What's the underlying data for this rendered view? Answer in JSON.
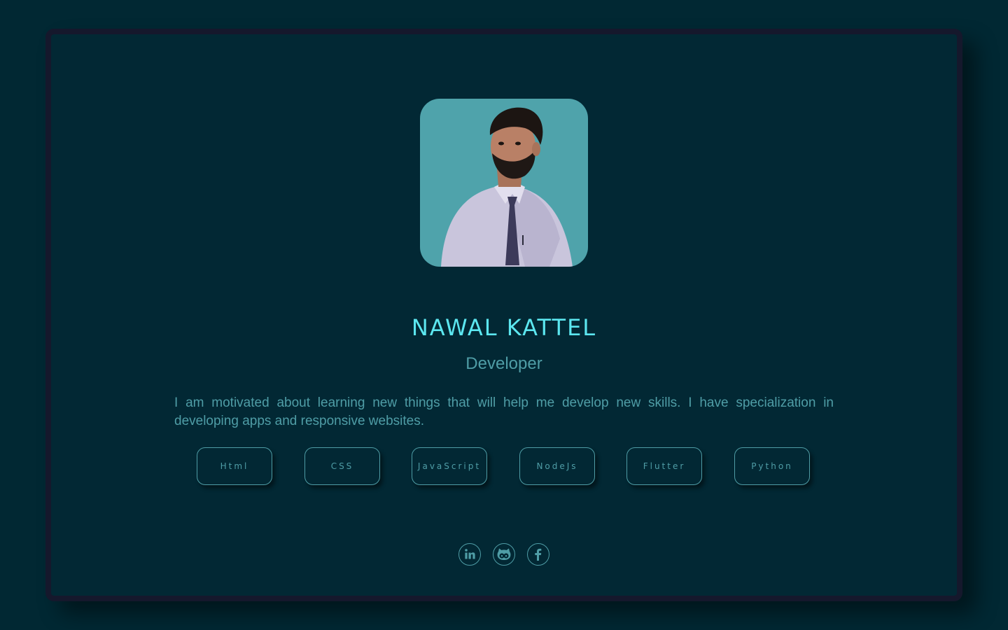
{
  "profile": {
    "name": "NAWAL KATTEL",
    "role": "Developer",
    "bio": "I am motivated about learning new things that will help me develop new skills. I have specialization in developing apps and responsive websites.",
    "avatar_icon": "profile-photo"
  },
  "skills": [
    {
      "label": "Html"
    },
    {
      "label": "CSS"
    },
    {
      "label": "JavaScript"
    },
    {
      "label": "NodeJs"
    },
    {
      "label": "Flutter"
    },
    {
      "label": "Python"
    }
  ],
  "socials": [
    {
      "icon": "linkedin-icon"
    },
    {
      "icon": "github-icon"
    },
    {
      "icon": "facebook-icon"
    }
  ],
  "colors": {
    "background": "#012833",
    "card": "#022834",
    "card_border": "#15182c",
    "accent": "#5ce7f0",
    "muted": "#4f9da6",
    "avatar_bg": "#4fa3ab"
  }
}
